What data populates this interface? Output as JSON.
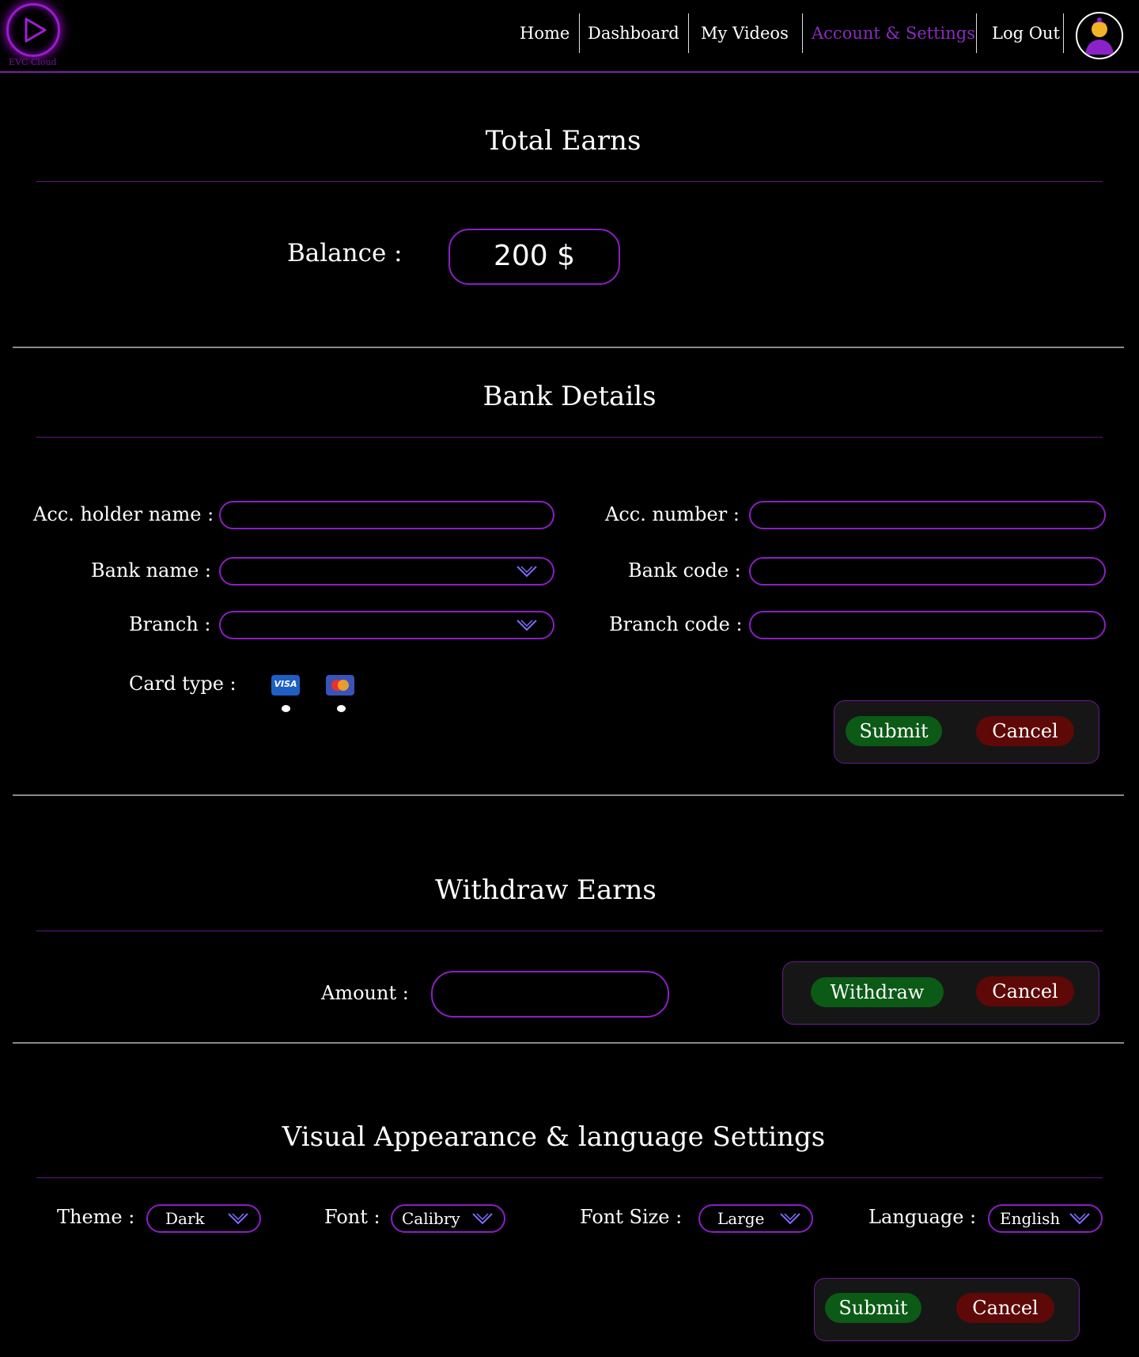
{
  "header": {
    "logo_text": "EVC Cloud",
    "nav": [
      "Home",
      "Dashboard",
      "My Videos",
      "Account & Settings",
      "Log Out"
    ],
    "active_nav": "Account & Settings"
  },
  "earns": {
    "title": "Total Earns",
    "balance_label": "Balance :",
    "balance_value": "200 $"
  },
  "bank": {
    "title": "Bank Details",
    "acc_holder_label": "Acc. holder name :",
    "acc_number_label": "Acc. number :",
    "bank_name_label": "Bank name :",
    "bank_code_label": "Bank code :",
    "branch_label": "Branch :",
    "branch_code_label": "Branch code :",
    "card_type_label": "Card type :",
    "visa_text": "VISA",
    "submit": "Submit",
    "cancel": "Cancel"
  },
  "withdraw": {
    "title": "Withdraw Earns",
    "amount_label": "Amount :",
    "withdraw": "Withdraw",
    "cancel": "Cancel"
  },
  "appearance": {
    "title": "Visual Appearance & language Settings",
    "theme_label": "Theme :",
    "theme_value": "Dark",
    "font_label": "Font :",
    "font_value": "Calibry",
    "font_size_label": "Font Size :",
    "font_size_value": "Large",
    "language_label": "Language :",
    "language_value": "English",
    "submit": "Submit",
    "cancel": "Cancel"
  },
  "colors": {
    "accent": "#8b1fc4",
    "active_nav": "#8a2bbf",
    "submit_green": "#0b5a16",
    "cancel_red": "#5e0808"
  }
}
